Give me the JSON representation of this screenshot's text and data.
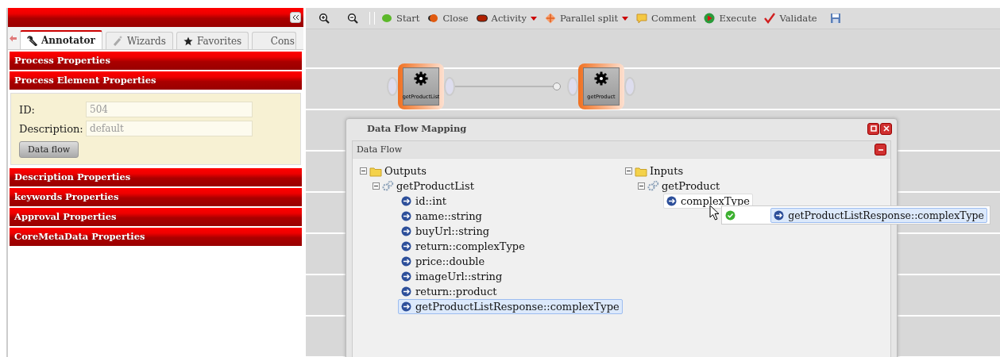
{
  "sidebar": {
    "tabs": [
      {
        "label": "Annotator",
        "kind": "wrench",
        "selected": true
      },
      {
        "label": "Wizards",
        "kind": "wand",
        "selected": false
      },
      {
        "label": "Favorites",
        "kind": "star",
        "selected": false
      },
      {
        "label": "Cons",
        "kind": "plain",
        "selected": false
      }
    ],
    "sections": [
      {
        "title": "Process Properties"
      },
      {
        "title": "Process Element Properties",
        "fields": [
          {
            "label": "ID:",
            "value": "504"
          },
          {
            "label": "Description:",
            "value": "default"
          }
        ],
        "button": "Data flow"
      },
      {
        "title": "Description Properties"
      },
      {
        "title": "keywords Properties"
      },
      {
        "title": "Approval Properties"
      },
      {
        "title": "CoreMetaData Properties"
      }
    ]
  },
  "toolbar": [
    {
      "kind": "zoom-in"
    },
    {
      "kind": "zoom-out"
    },
    {
      "kind": "separator"
    },
    {
      "kind": "start",
      "label": "Start"
    },
    {
      "kind": "close",
      "label": "Close"
    },
    {
      "kind": "activity",
      "label": "Activity",
      "dropdown": true
    },
    {
      "kind": "split",
      "label": "Parallel split",
      "dropdown": true
    },
    {
      "kind": "comment",
      "label": "Comment"
    },
    {
      "kind": "execute",
      "label": "Execute"
    },
    {
      "kind": "validate",
      "label": "Validate"
    },
    {
      "kind": "save"
    }
  ],
  "diagram": {
    "nodes": [
      {
        "label": "getProductList"
      },
      {
        "label": "getProduct"
      }
    ]
  },
  "dialog": {
    "title": "Data Flow Mapping",
    "panel_title": "Data Flow",
    "trees": [
      {
        "label": "Outputs",
        "expanded": true,
        "children": [
          {
            "label": "getProductList",
            "expanded": true,
            "children": [
              {
                "label": "id::int",
                "selected": false,
                "hovered": false
              },
              {
                "label": "name::string",
                "selected": false,
                "hovered": false
              },
              {
                "label": "buyUrl::string",
                "selected": false,
                "hovered": false
              },
              {
                "label": "return::complexType",
                "selected": false,
                "hovered": false
              },
              {
                "label": "price::double",
                "selected": false,
                "hovered": false
              },
              {
                "label": "imageUrl::string",
                "selected": false,
                "hovered": false
              },
              {
                "label": "return::product",
                "selected": false,
                "hovered": false
              },
              {
                "label": "getProductListResponse::complexType",
                "selected": true,
                "hovered": false
              }
            ]
          }
        ]
      },
      {
        "label": "Inputs",
        "expanded": true,
        "children": [
          {
            "label": "getProduct",
            "expanded": true,
            "children": [
              {
                "label": "complexType",
                "selected": false,
                "hovered": true
              }
            ]
          }
        ]
      }
    ],
    "drop_hint": {
      "label": "getProductListResponse::complexType"
    }
  }
}
